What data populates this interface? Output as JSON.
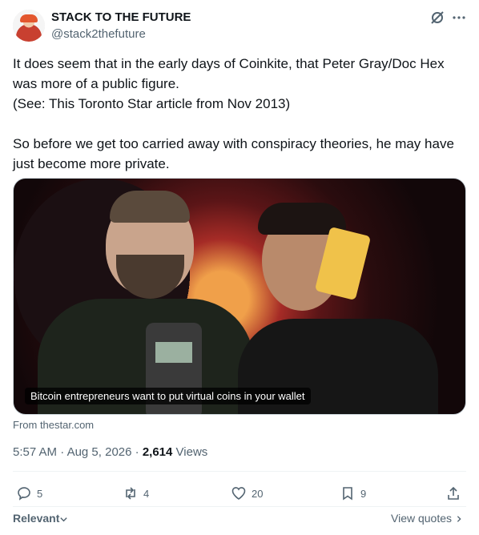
{
  "author": {
    "name": "STACK TO THE FUTURE",
    "handle": "@stack2thefuture"
  },
  "tweet": {
    "paragraphs": [
      "It does seem that in the early days of Coinkite, that Peter Gray/Doc Hex was more of a public figure.",
      "(See: This Toronto Star article from Nov 2013)",
      "",
      "So before we get too carried away with conspiracy theories, he may have just become more private."
    ]
  },
  "media": {
    "caption": "Bitcoin entrepreneurs want to put virtual coins in your wallet",
    "source": "From thestar.com"
  },
  "meta": {
    "time": "5:57 AM",
    "date": "Aug 5, 2026",
    "separator": "·",
    "views_count": "2,614",
    "views_label": "Views"
  },
  "actions": {
    "replies": "5",
    "reposts": "4",
    "likes": "20",
    "bookmarks": "9"
  },
  "footer": {
    "relevant_label": "Relevant",
    "view_quotes_label": "View quotes"
  },
  "icons": [
    "grok-icon",
    "more-icon",
    "reply-icon",
    "repost-icon",
    "like-icon",
    "bookmark-icon",
    "share-icon",
    "chevron-down-icon",
    "chevron-right-icon"
  ]
}
